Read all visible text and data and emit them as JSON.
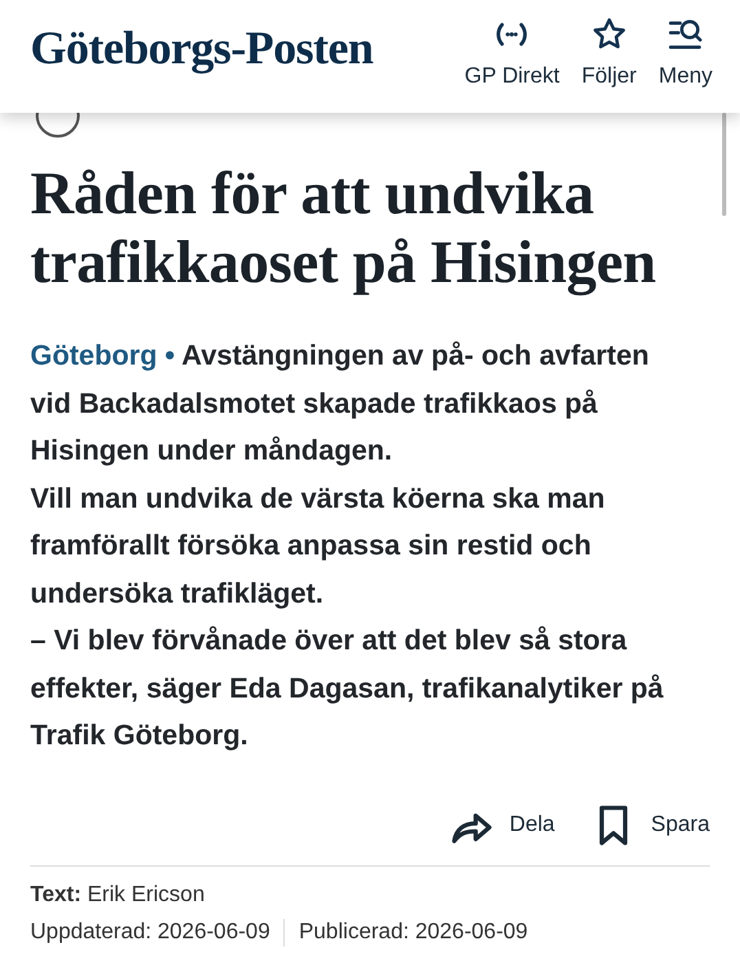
{
  "header": {
    "logo": "Göteborgs-Posten",
    "nav": [
      {
        "kind": "live",
        "label": "GP Direkt"
      },
      {
        "kind": "star",
        "label": "Följer"
      },
      {
        "kind": "menu",
        "label": "Meny"
      }
    ]
  },
  "article": {
    "headline": "Råden för att undvika trafikkaoset på Hisingen",
    "dateline": "Göteborg",
    "dateline_separator": "•",
    "lead": [
      "Avstängningen av på- och avfarten vid Backadalsmotet skapade trafikkaos på Hisingen under måndagen.",
      "Vill man undvika de värsta köerna ska man framförallt försöka anpassa sin restid och undersöka trafikläget.",
      "– Vi blev förvånade över att det blev så stora effekter, säger Eda Dagasan, trafikanalytiker på Trafik Göteborg."
    ],
    "actions": [
      {
        "kind": "share",
        "label": "Dela"
      },
      {
        "kind": "save",
        "label": "Spara"
      }
    ],
    "byline": {
      "label": "Text:",
      "name": "Erik Ericson"
    },
    "dates": [
      {
        "label": "Uppdaterad:",
        "value": "2026-06-09"
      },
      {
        "label": "Publicerad:",
        "value": "2026-06-09"
      }
    ]
  }
}
